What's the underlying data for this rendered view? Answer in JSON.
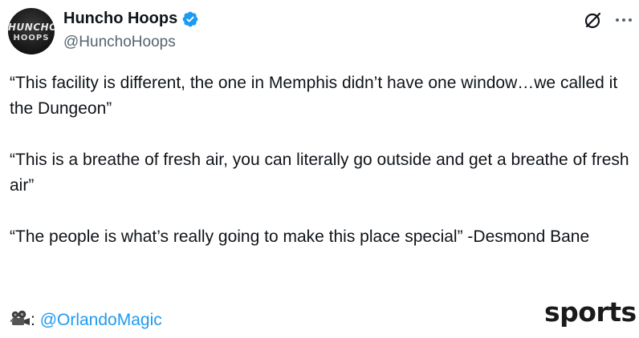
{
  "author": {
    "display_name": "Huncho Hoops",
    "handle": "@HunchoHoops",
    "verified": true,
    "avatar_text": [
      "HUNCHO",
      "HOOPS"
    ]
  },
  "actions": {
    "grok_icon": "slashed-circle-icon",
    "more_icon": "more-icon"
  },
  "post": {
    "paragraphs": [
      "“This facility is different, the one in Memphis didn’t have one window…we called it the Dungeon”",
      "“This is a breathe of fresh air, you can literally go outside and get a breathe of fresh air”",
      "“The people is what’s really going to make this place special” -Desmond Bane"
    ],
    "credit_icon": "movie-camera-icon",
    "credit_separator": ":",
    "credit_mention": "@OrlandoMagic"
  },
  "watermark": "sports",
  "colors": {
    "text": "#0f1419",
    "secondary": "#536471",
    "link": "#1d9bf0",
    "verified": "#1d9bf0"
  }
}
